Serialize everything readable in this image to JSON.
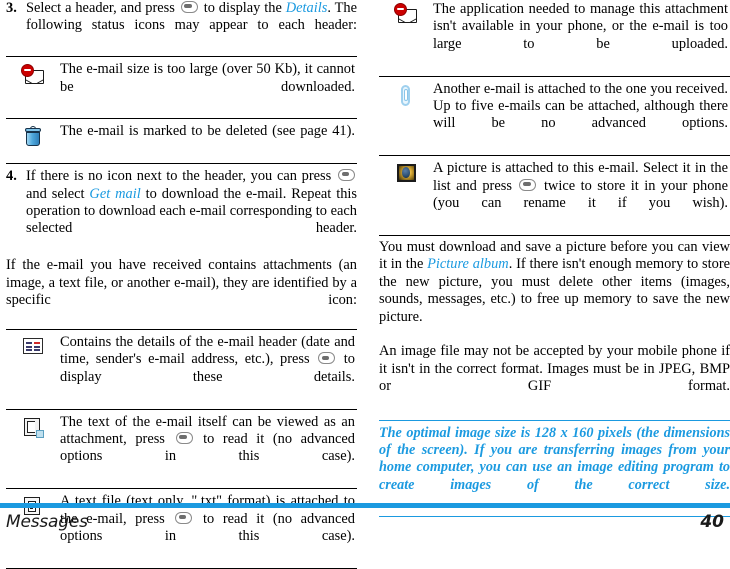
{
  "footer": {
    "chapter": "Messages",
    "page_number": "40",
    "accent_color": "#1b9ae0"
  },
  "left_column": {
    "step3": {
      "number": "3.",
      "text_before": "Select a header, and press",
      "text_after_key": "to display the",
      "link": "Details",
      "text_tail": ". The following status icons may appear to each header:"
    },
    "status_icons": [
      {
        "icon": "mail-too-large-icon",
        "text": "The e-mail size is too large (over 50 Kb), it cannot be downloaded."
      },
      {
        "icon": "trash-icon",
        "text": "The e-mail is marked to be deleted (see page 41)."
      }
    ],
    "step4": {
      "number": "4.",
      "text_before": "If there is no icon next to the header, you can press",
      "text_after_key": "and select",
      "link": "Get mail",
      "text_tail": "to download the e-mail. Repeat this operation to download each e-mail corresponding to each selected header."
    },
    "attachment_intro": "If the e-mail you have received contains attachments (an image, a text file, or another e-mail), they are identified by a specific icon:",
    "attachment_icons": [
      {
        "icon": "header-details-icon",
        "text_before": "Contains the details of the e-mail header (date and time, sender's e-mail address, etc.), press",
        "text_after_key": "to display these details."
      },
      {
        "icon": "email-text-attachment-icon",
        "text_before": "The text of the e-mail itself can be viewed as an attachment, press",
        "text_after_key": "to read it (no advanced options in this case)."
      },
      {
        "icon": "text-file-icon",
        "text_before": "A text file (text only, \".txt\" format) is attached to the e-mail, press",
        "text_after_key": "to read it (no advanced options in this case)."
      }
    ]
  },
  "right_column": {
    "attachment_icons": [
      {
        "icon": "unsupported-attachment-icon",
        "text": "The application needed to manage this attachment isn't available in your phone, or the e-mail is too large to be uploaded."
      },
      {
        "icon": "paperclip-icon",
        "text": "Another e-mail is attached to the one you received. Up to five e-mails can be attached, although there will be no advanced options."
      },
      {
        "icon": "picture-attachment-icon",
        "text_before": "A picture is attached to this e-mail. Select it in the list and press",
        "text_after_key": "twice to store it in your phone (you can rename it if you wish)."
      }
    ],
    "paragraph_1_before": "You must download and save a picture before you can view it in the",
    "paragraph_1_link": "Picture album",
    "paragraph_1_after": ". If there isn't enough memory to store the new picture, you must delete other items (images, sounds, messages, etc.) to free up memory to save the new picture.",
    "paragraph_2": "An image file may not be accepted by your mobile phone if it isn't in the correct format. Images must be in JPEG, BMP or GIF format.",
    "note": "The optimal image size is 128 x 160 pixels (the dimensions of the screen). If you are transferring images from your home computer, you can use an image editing program to create images of the correct size."
  }
}
